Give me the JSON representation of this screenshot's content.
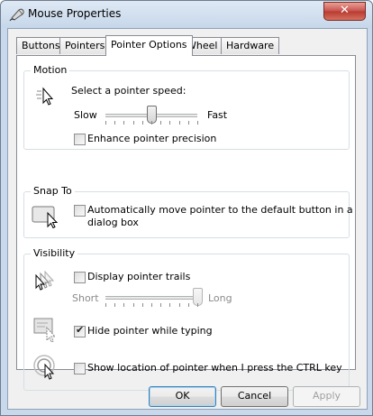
{
  "window": {
    "title": "Mouse Properties",
    "close_label": "✕"
  },
  "tabs": [
    {
      "label": "Buttons",
      "active": false
    },
    {
      "label": "Pointers",
      "active": false
    },
    {
      "label": "Pointer Options",
      "active": true
    },
    {
      "label": "Wheel",
      "active": false
    },
    {
      "label": "Hardware",
      "active": false
    }
  ],
  "motion": {
    "legend": "Motion",
    "speed_label": "Select a pointer speed:",
    "slow_label": "Slow",
    "fast_label": "Fast",
    "speed_level": 0.5,
    "precision_label": "Enhance pointer precision",
    "precision_checked": false
  },
  "snap_to": {
    "legend": "Snap To",
    "line1": "Automatically move pointer to the default button in a",
    "line2": "dialog box",
    "checked": false
  },
  "visibility": {
    "legend": "Visibility",
    "trails_label": "Display pointer trails",
    "trails_checked": false,
    "short_label": "Short",
    "long_label": "Long",
    "trail_level": 1.0,
    "hide_label": "Hide pointer while typing",
    "hide_checked": true,
    "ctrl_label": "Show location of pointer when I press the CTRL key",
    "ctrl_checked": false
  },
  "buttons": {
    "ok": "OK",
    "cancel": "Cancel",
    "apply": "Apply"
  },
  "check_glyph": "✔"
}
